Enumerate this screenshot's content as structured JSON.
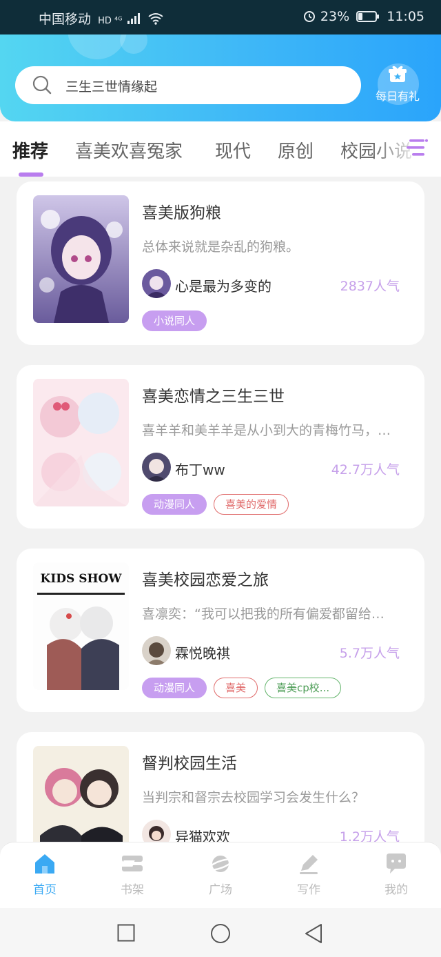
{
  "status": {
    "carrier": "中国移动",
    "network": "HD ⁴ᴳ",
    "battery": "23%",
    "time": "11:05"
  },
  "search": {
    "placeholder": "三生三世情缘起"
  },
  "gift": {
    "label": "每日有礼",
    "icon": "gift-icon"
  },
  "tabs": [
    {
      "label": "推荐",
      "active": true
    },
    {
      "label": "喜美欢喜冤家"
    },
    {
      "label": "现代"
    },
    {
      "label": "原创"
    },
    {
      "label": "校园小说"
    }
  ],
  "cards": [
    {
      "title": "喜美版狗粮",
      "desc": "总体来说就是杂乱的狗粮。",
      "author": "心是最为多变的",
      "popularity": "2837人气",
      "tags": [
        "小说同人"
      ]
    },
    {
      "title": "喜美恋情之三生三世",
      "desc": "喜羊羊和美羊羊是从小到大的青梅竹马，…",
      "author": "布丁ww",
      "popularity": "42.7万人气",
      "tags": [
        "动漫同人",
        "喜美的爱情"
      ]
    },
    {
      "title": "喜美校园恋爱之旅",
      "desc": "喜凛奕：“我可以把我的所有偏爱都留给…",
      "author": "霖悦晚祺",
      "popularity": "5.7万人气",
      "cover_text": "KIDS SHOW",
      "tags": [
        "动漫同人",
        "喜美",
        "喜美cp校..."
      ]
    },
    {
      "title": "督判校园生活",
      "desc": "当判宗和督宗去校园学习会发生什么？",
      "author": "异猫欢欢",
      "popularity": "1.2万人气",
      "tags": []
    }
  ],
  "nav": [
    {
      "label": "首页",
      "icon": "home-icon",
      "active": true
    },
    {
      "label": "书架",
      "icon": "bookshelf-icon"
    },
    {
      "label": "广场",
      "icon": "planet-icon"
    },
    {
      "label": "写作",
      "icon": "pen-icon"
    },
    {
      "label": "我的",
      "icon": "chat-bubble-icon"
    }
  ],
  "colors": {
    "header_start": "#54d6f1",
    "header_end": "#2aa4fb",
    "accent": "#b97dee",
    "popularity": "#c6a0ea",
    "nav_active": "#3aa9f3"
  }
}
